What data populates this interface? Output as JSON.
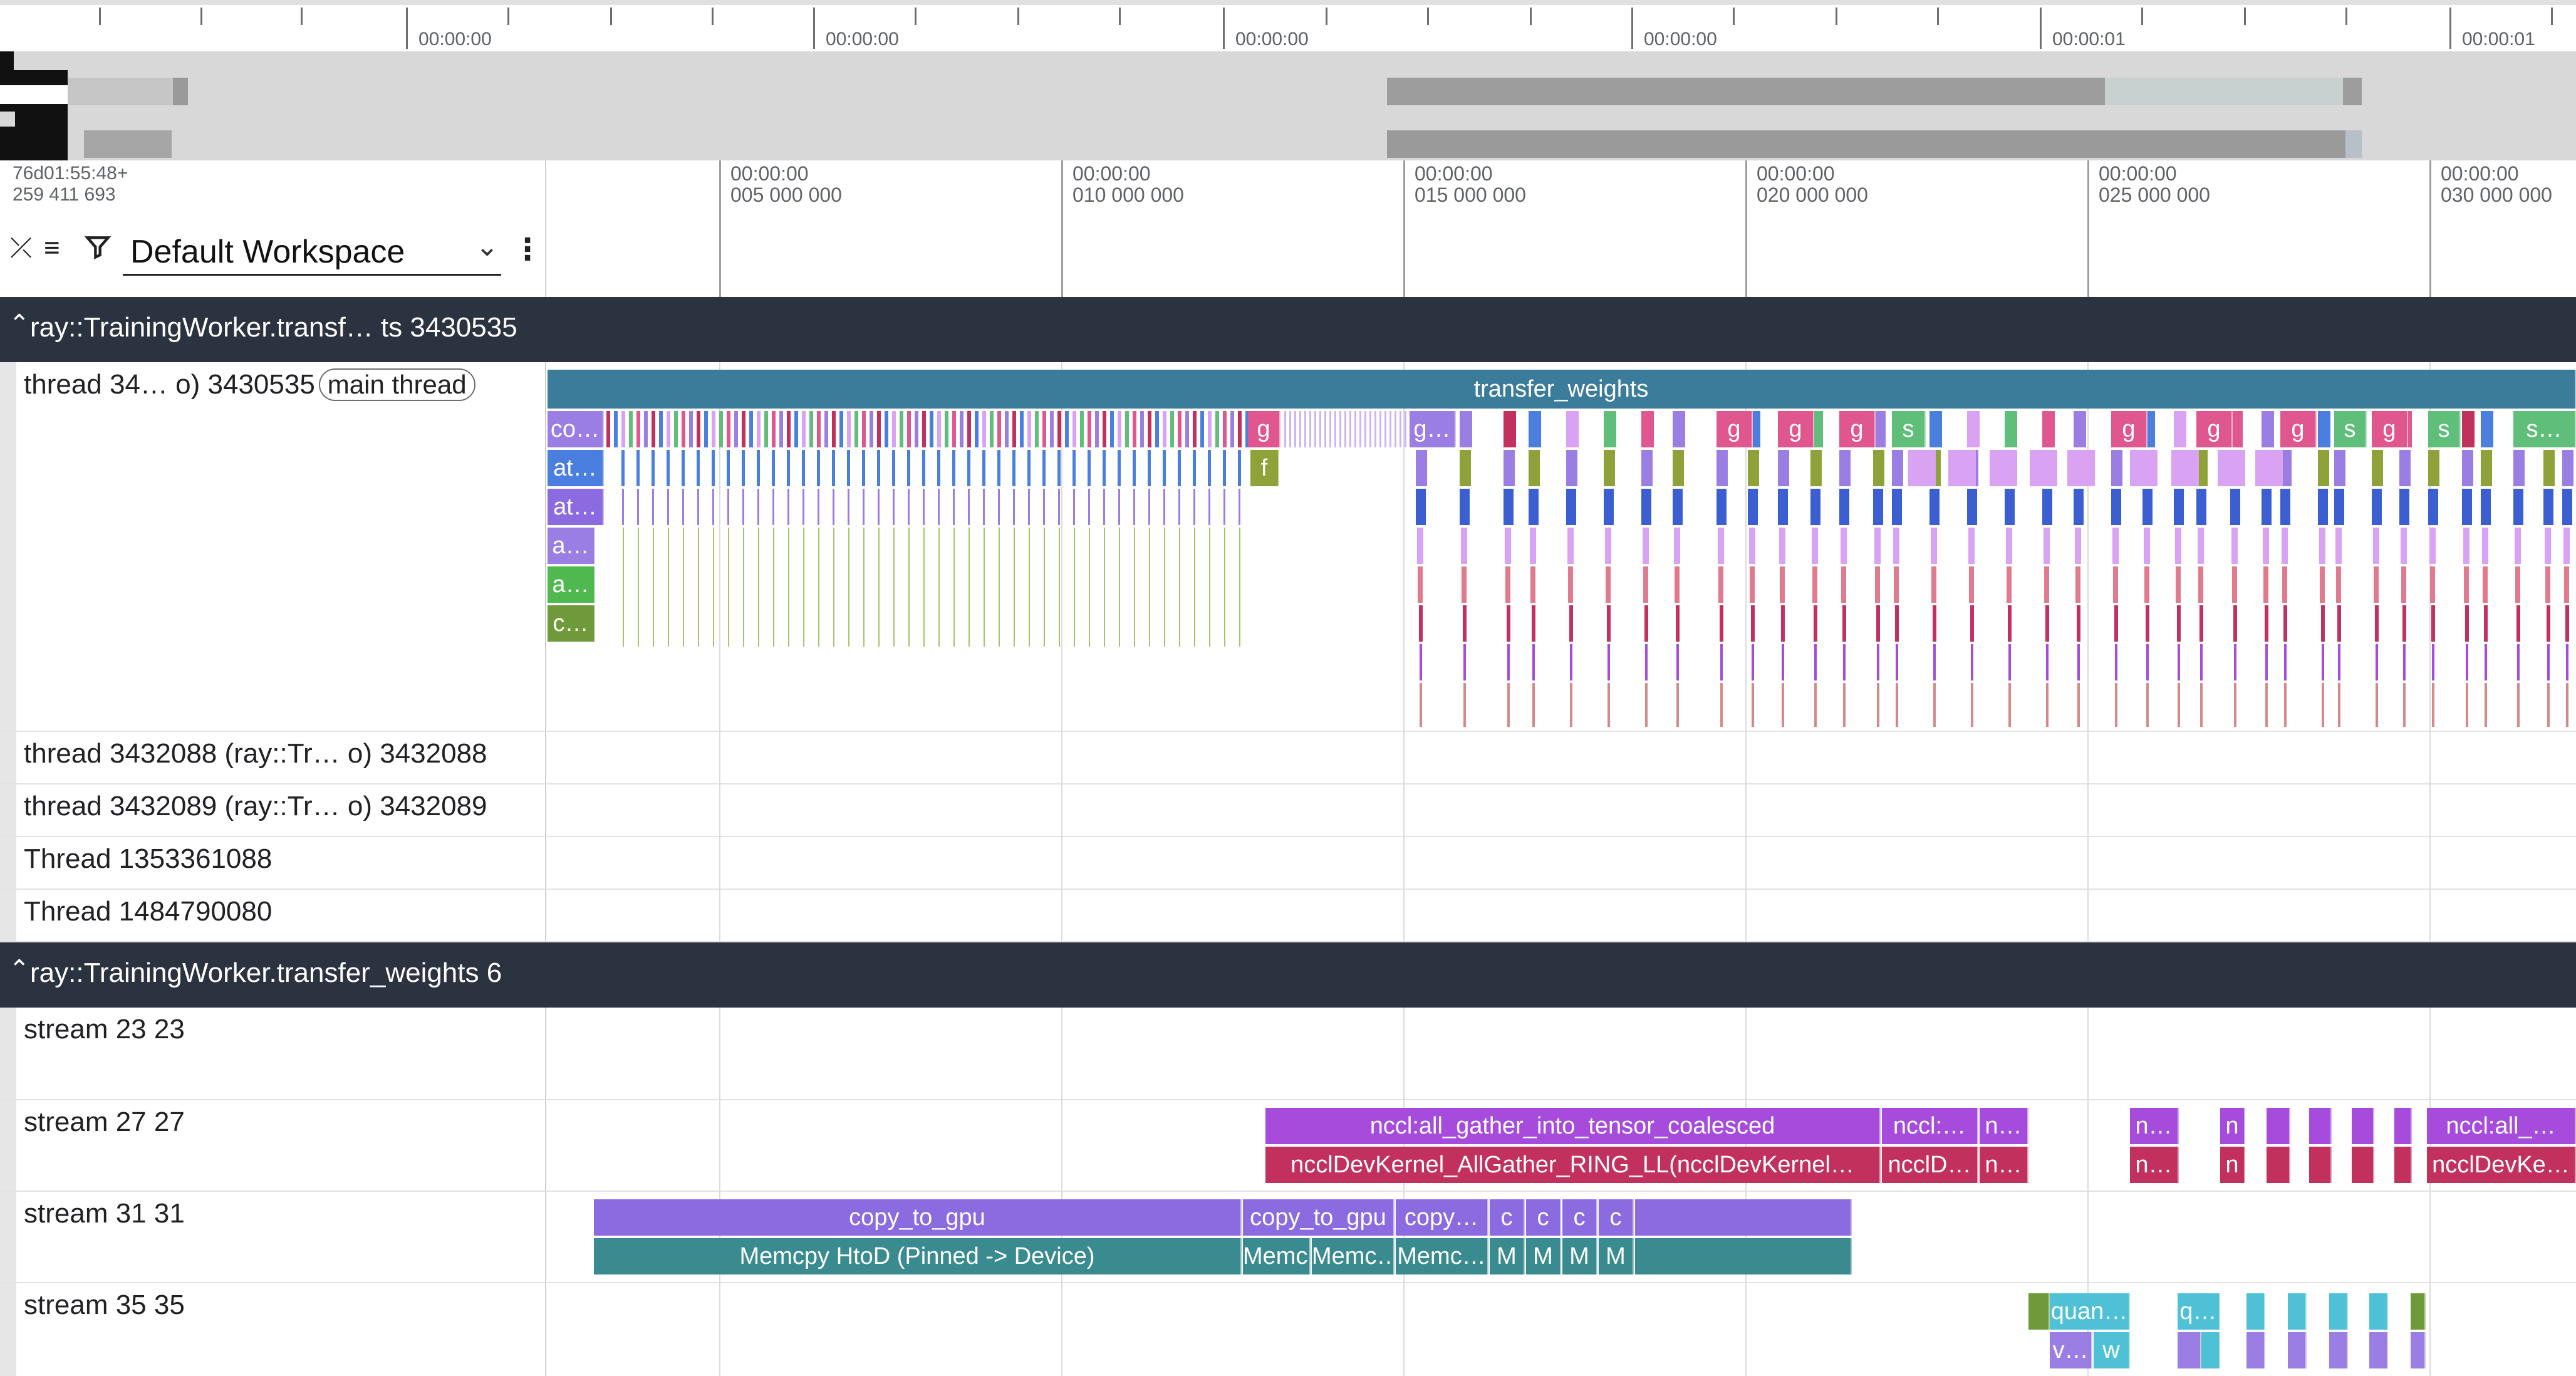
{
  "overview": {
    "tick_labels": [
      "00:00:00",
      "00:00:00",
      "00:00:00",
      "00:00:00",
      "00:00:01",
      "00:00:01"
    ]
  },
  "header": {
    "timestamp_offset_line1": "76d01:55:48+",
    "timestamp_offset_line2": "259 411 693",
    "workspace_name": "Default Workspace",
    "icons": [
      "collapse-all-icon",
      "list-icon",
      "filter-icon",
      "chevron-down-icon",
      "more-vert-icon"
    ]
  },
  "ruler": {
    "ticks": [
      {
        "time": "00:00:00",
        "ns": "005 000 000"
      },
      {
        "time": "00:00:00",
        "ns": "010 000 000"
      },
      {
        "time": "00:00:00",
        "ns": "015 000 000"
      },
      {
        "time": "00:00:00",
        "ns": "020 000 000"
      },
      {
        "time": "00:00:00",
        "ns": "025 000 000"
      },
      {
        "time": "00:00:00",
        "ns": "030 000 000"
      }
    ]
  },
  "processes": [
    {
      "title": "ray::TrainingWorker.transf…  ts 3430535",
      "tracks": [
        {
          "name": "thread 34… o) 3430535",
          "badge": "main thread"
        },
        {
          "name": "thread 3432088 (ray::Tr… o) 3432088"
        },
        {
          "name": "thread 3432089 (ray::Tr… o) 3432089"
        },
        {
          "name": "Thread 1353361088"
        },
        {
          "name": "Thread 1484790080"
        }
      ]
    },
    {
      "title": "ray::TrainingWorker.transfer_weights 6",
      "tracks": [
        {
          "name": "stream 23 23"
        },
        {
          "name": "stream 27 27"
        },
        {
          "name": "stream 31 31"
        },
        {
          "name": "stream 35 35"
        }
      ]
    }
  ],
  "slices": {
    "transfer_weights": "transfer_weights",
    "main_depth1": [
      "co…",
      "g",
      "g…",
      "g",
      "g",
      "g",
      "s",
      "g",
      "g",
      "g",
      "s",
      "g",
      "s",
      "s…"
    ],
    "main_depth2": [
      "at…",
      "f"
    ],
    "main_depth3": [
      "at…"
    ],
    "main_depth4": [
      "a…"
    ],
    "main_depth5": [
      "a…"
    ],
    "main_depth6": [
      "c…"
    ],
    "stream27_top": [
      "nccl:all_gather_into_tensor_coalesced",
      "nccl:…",
      "n…",
      "n…",
      "n",
      "nccl:all_…"
    ],
    "stream27_bottom": [
      "ncclDevKernel_AllGather_RING_LL(ncclDevKernel…",
      "ncclD…",
      "n…",
      "n…",
      "n",
      "ncclDevKe…"
    ],
    "stream31_top": [
      "copy_to_gpu",
      "copy_to_gpu",
      "copy…",
      "c",
      "c",
      "c",
      "c"
    ],
    "stream31_bottom": [
      "Memcpy HtoD (Pinned -> Device)",
      "Memc…",
      "Memc…",
      "Memc…",
      "M",
      "M",
      "M",
      "M"
    ],
    "stream35_top": [
      "quan…",
      "q…"
    ],
    "stream35_bottom": [
      "v…",
      "w"
    ]
  },
  "colors": {
    "process_header_bg": "#2b3340",
    "transfer_weights": "#3a7c9a",
    "copy_to_gpu": "#8c6be0",
    "memcpy": "#3a8b8f",
    "nccl_top": "#a64bdc",
    "nccl_bottom": "#c2305e",
    "quant": "#4fc1d6"
  }
}
